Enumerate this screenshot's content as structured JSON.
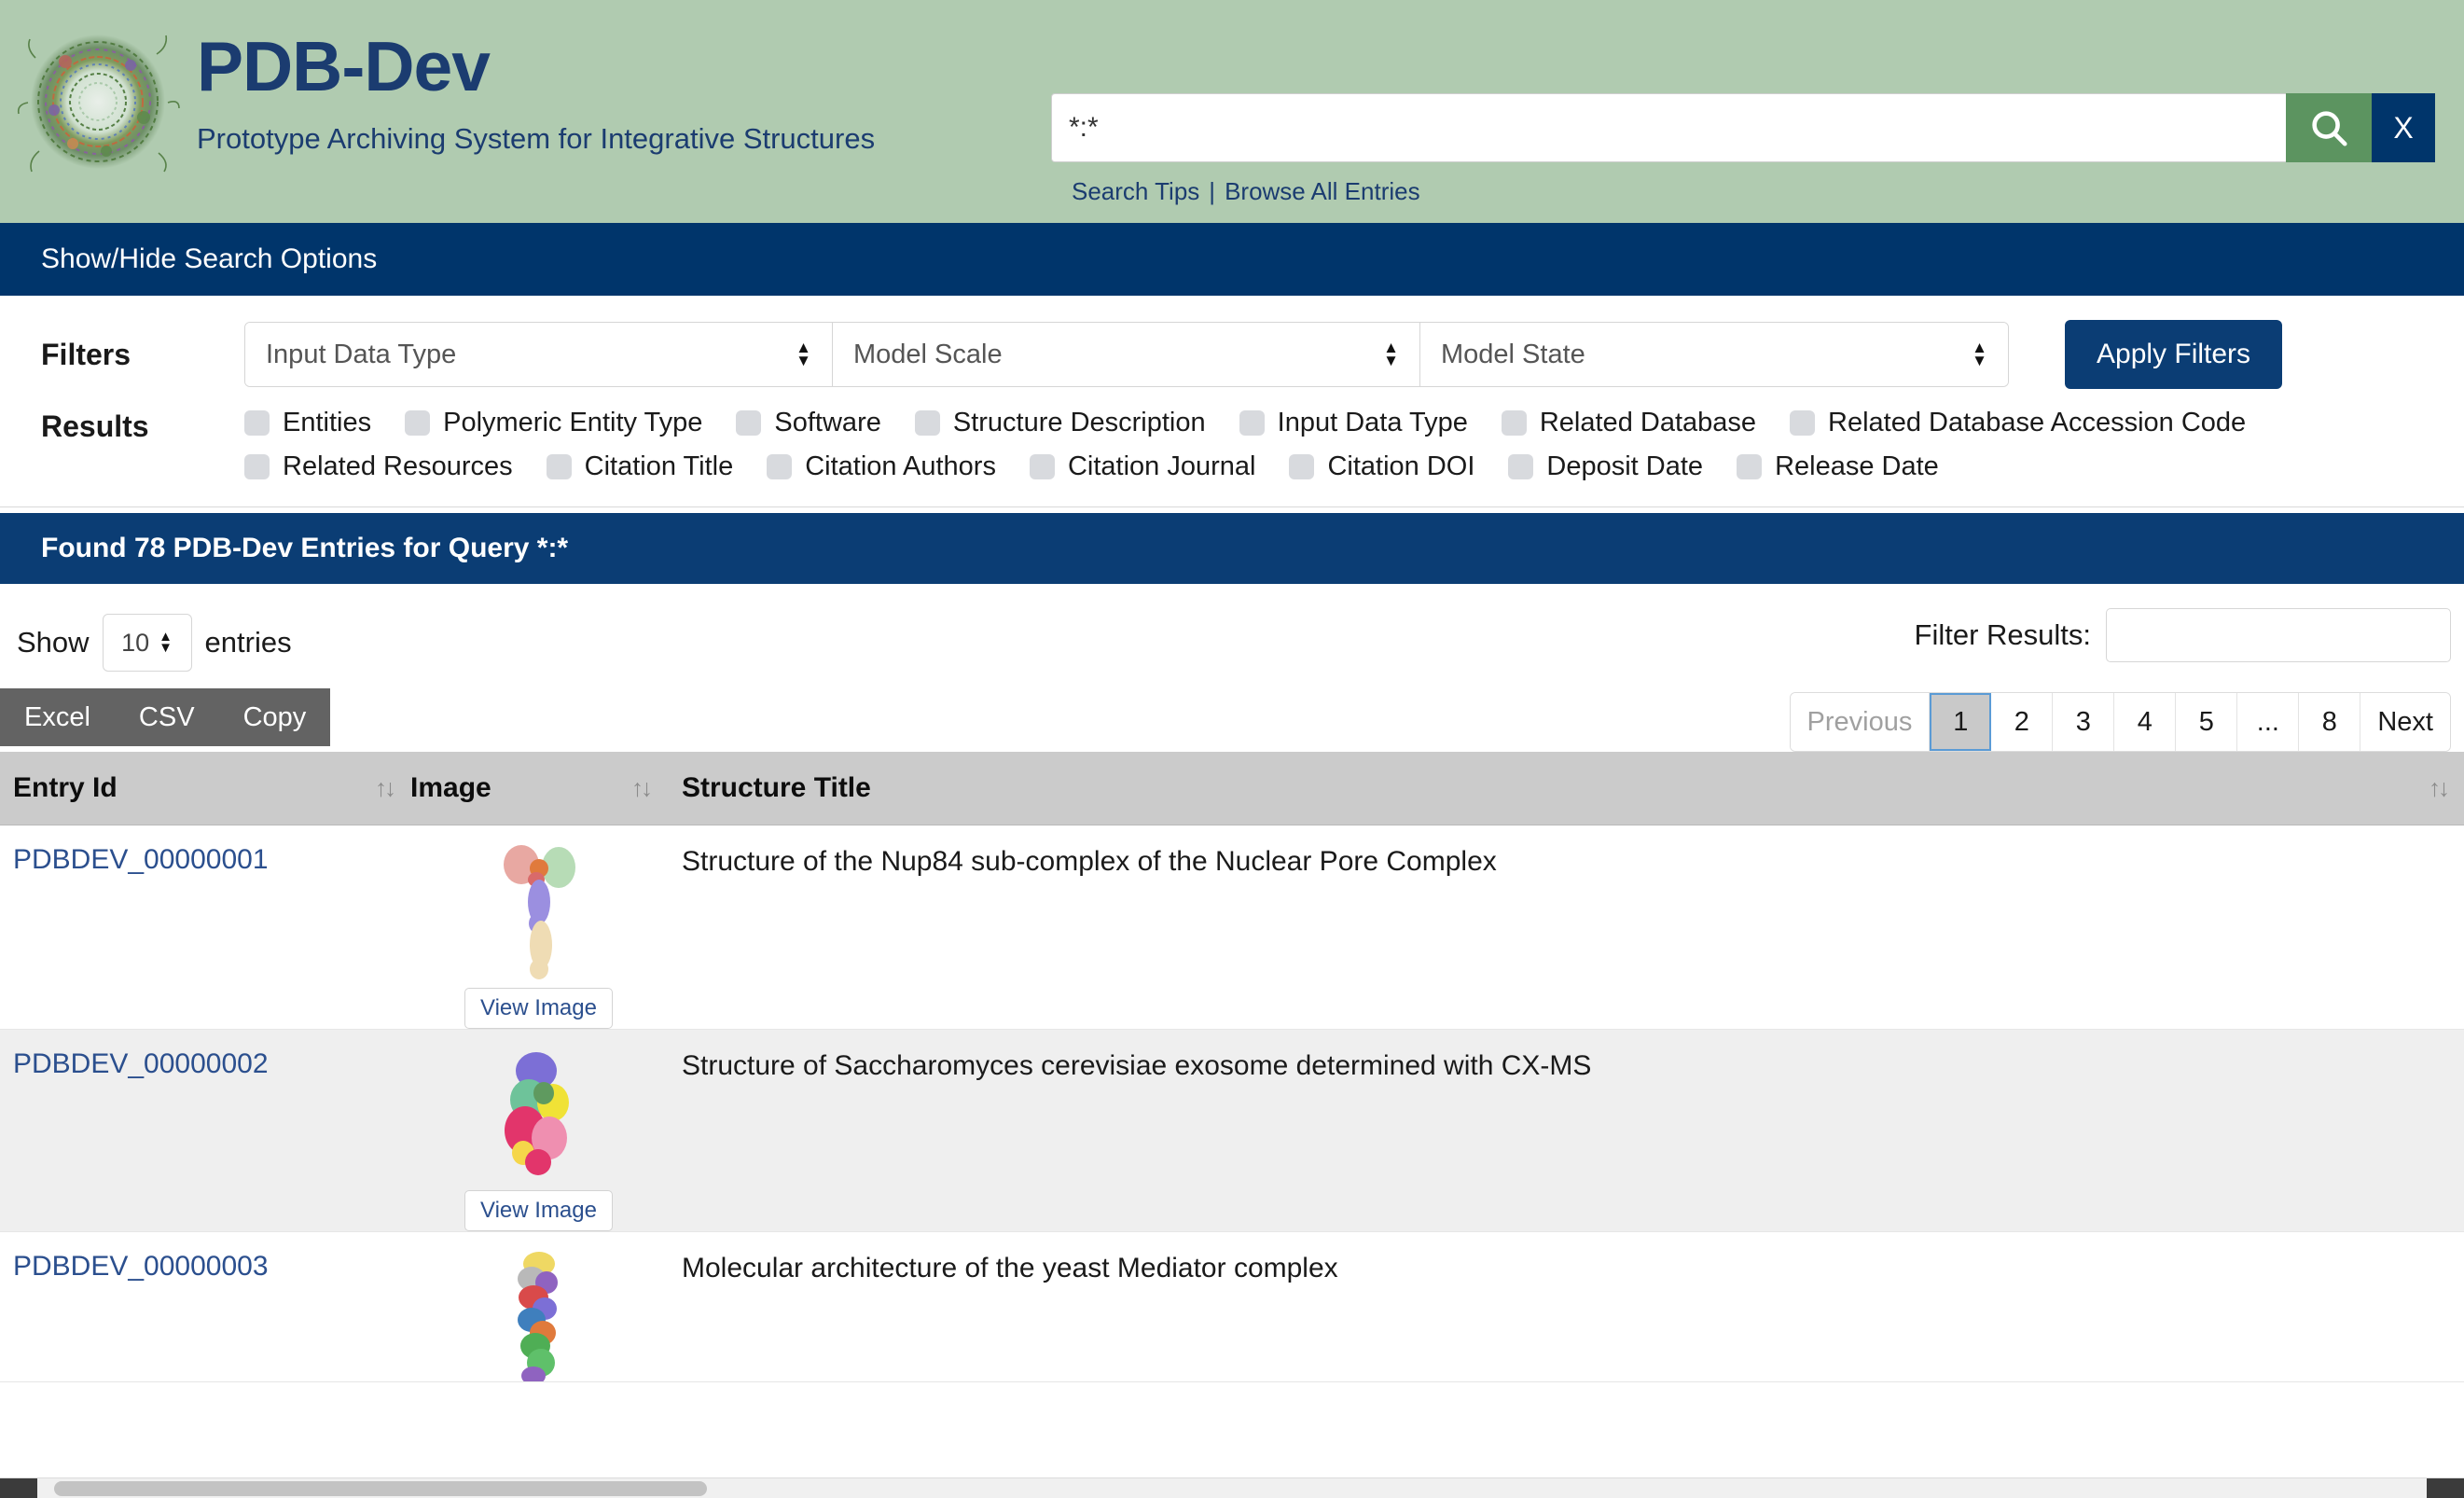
{
  "site": {
    "title": "PDB-Dev",
    "tagline": "Prototype Archiving System for Integrative Structures",
    "logo_icon": "molecular-capsid-logo",
    "brand_color": "#1b3c70",
    "header_bg": "#b0cbb0",
    "accent_blue": "#00356b",
    "accent_green": "#5c9460"
  },
  "search": {
    "value": "*:*",
    "placeholder": "",
    "search_icon": "magnifier-icon",
    "clear_label": "X",
    "tips_label": "Search Tips",
    "separator": "|",
    "browse_label": "Browse All Entries"
  },
  "options_bar": {
    "label": "Show/Hide Search Options"
  },
  "filters": {
    "label": "Filters",
    "selects": [
      {
        "name": "input-data-type",
        "selected": "Input Data Type"
      },
      {
        "name": "model-scale",
        "selected": "Model Scale"
      },
      {
        "name": "model-state",
        "selected": "Model State"
      }
    ],
    "apply_label": "Apply Filters"
  },
  "results_columns": {
    "label": "Results",
    "checkboxes": [
      {
        "label": "Entities",
        "checked": false
      },
      {
        "label": "Polymeric Entity Type",
        "checked": false
      },
      {
        "label": "Software",
        "checked": false
      },
      {
        "label": "Structure Description",
        "checked": false
      },
      {
        "label": "Input Data Type",
        "checked": false
      },
      {
        "label": "Related Database",
        "checked": false
      },
      {
        "label": "Related Database Accession Code",
        "checked": false
      },
      {
        "label": "Related Resources",
        "checked": false
      },
      {
        "label": "Citation Title",
        "checked": false
      },
      {
        "label": "Citation Authors",
        "checked": false
      },
      {
        "label": "Citation Journal",
        "checked": false
      },
      {
        "label": "Citation DOI",
        "checked": false
      },
      {
        "label": "Deposit Date",
        "checked": false
      },
      {
        "label": "Release Date",
        "checked": false
      }
    ]
  },
  "found_banner": {
    "text": "Found 78 PDB-Dev Entries for Query *:*",
    "count": 78,
    "query": "*:*"
  },
  "table_controls": {
    "show_label": "Show",
    "entries_label": "entries",
    "page_length": "10",
    "export_buttons": [
      "Excel",
      "CSV",
      "Copy"
    ],
    "filter_label": "Filter Results:",
    "filter_value": "",
    "filter_placeholder": ""
  },
  "pagination": {
    "previous_label": "Previous",
    "next_label": "Next",
    "pages": [
      "1",
      "2",
      "3",
      "4",
      "5",
      "...",
      "8"
    ],
    "active_page": "1",
    "previous_disabled": true
  },
  "table": {
    "headers": [
      {
        "label": "Entry Id",
        "sortable": true,
        "sort_icon": "sort-updown-icon"
      },
      {
        "label": "Image",
        "sortable": true,
        "sort_icon": "sort-updown-icon"
      },
      {
        "label": "Structure Title",
        "sortable": true,
        "sort_icon": "sort-updown-icon"
      }
    ],
    "view_image_label": "View Image",
    "rows": [
      {
        "entry_id": "PDBDEV_00000001",
        "title": "Structure of the Nup84 sub-complex of the Nuclear Pore Complex",
        "thumb": "nup84-complex-thumbnail"
      },
      {
        "entry_id": "PDBDEV_00000002",
        "title": "Structure of Saccharomyces cerevisiae exosome determined with CX-MS",
        "thumb": "exosome-thumbnail"
      },
      {
        "entry_id": "PDBDEV_00000003",
        "title": "Molecular architecture of the yeast Mediator complex",
        "thumb": "mediator-complex-thumbnail"
      }
    ]
  }
}
